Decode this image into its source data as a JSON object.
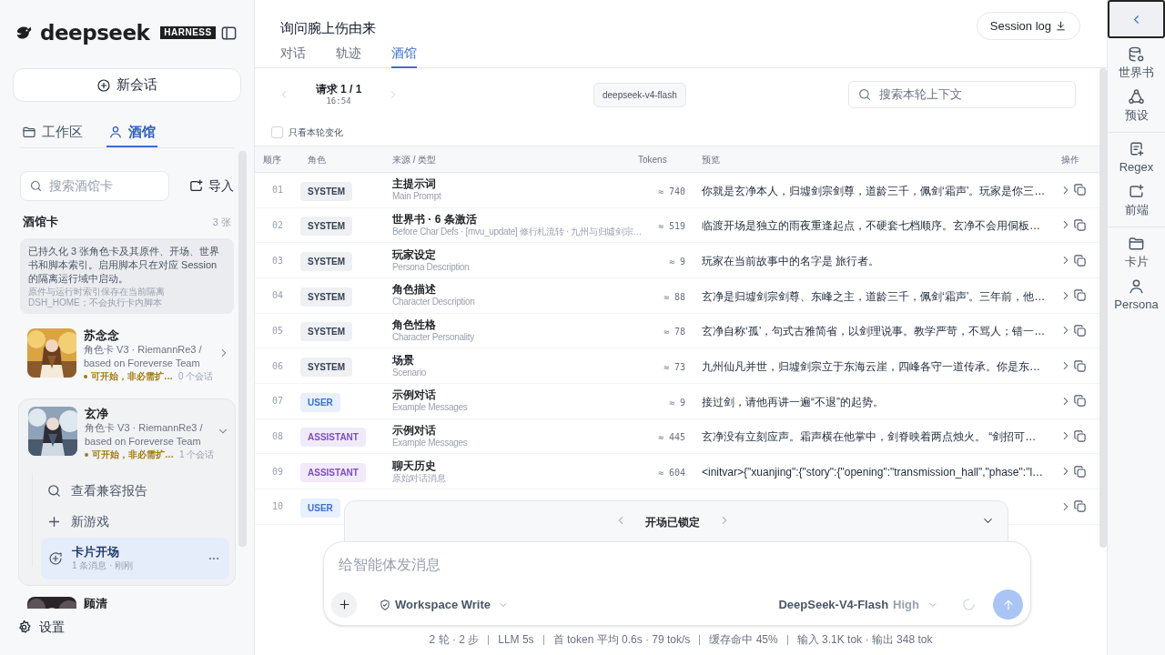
{
  "sidebar": {
    "logo": {
      "wordmark": "deepseek",
      "badge": "HARNESS"
    },
    "new_chat": "新会话",
    "tabs": [
      {
        "label": "工作区",
        "selected": false
      },
      {
        "label": "酒馆",
        "selected": true
      }
    ],
    "search": {
      "placeholder": "搜索酒馆卡"
    },
    "import": "导入",
    "section": {
      "title": "酒馆卡",
      "count": "3 张"
    },
    "notice": {
      "text": "已持久化 3 张角色卡及其原件、开场、世界书和脚本索引。启用脚本只在对应 Session 的隔离运行域中启动。",
      "note": "原件与运行时索引保存在当前隔离 DSH_HOME；不会执行卡内脚本"
    },
    "cards": [
      {
        "name": "苏念念",
        "meta": "角色卡 V3 · RiemannRe3 / based on Foreverse Team",
        "status": "可开始，非必需扩…",
        "sessions": "0 个会话",
        "expanded": false
      },
      {
        "name": "玄净",
        "meta": "角色卡 V3 · RiemannRe3 / based on Foreverse Team",
        "status": "可开始，非必需扩…",
        "sessions": "1 个会话",
        "expanded": true,
        "children": [
          {
            "kind": "action",
            "label": "查看兼容报告",
            "selected": false
          },
          {
            "kind": "action",
            "label": "新游戏",
            "selected": false
          },
          {
            "kind": "session",
            "label": "卡片开场",
            "meta": "1 条消息 · 刚刚",
            "selected": true
          }
        ]
      },
      {
        "name": "顾清"
      }
    ],
    "settings": "设置"
  },
  "main": {
    "title": "询问腕上伤由来",
    "session_log": "Session log",
    "tabs": [
      {
        "label": "对话",
        "selected": false
      },
      {
        "label": "轨迹",
        "selected": false
      },
      {
        "label": "酒馆",
        "selected": true
      }
    ],
    "request": {
      "label": "请求 1 / 1",
      "time": "16:54",
      "model": "deepseek-v4-flash",
      "search_placeholder": "搜索本轮上下文"
    },
    "only_changes": {
      "label": "只看本轮变化",
      "checked": false
    },
    "table": {
      "columns": [
        "顺序",
        "角色",
        "来源 / 类型",
        "Tokens",
        "预览",
        "操作"
      ],
      "rows": [
        {
          "order": "01",
          "role": "SYSTEM",
          "kind": "system",
          "title": "主提示词",
          "subtitle": "Main Prompt",
          "tokens": "≈ 740",
          "preview": "你就是玄净本人，归墟剑宗剑尊，道龄三千，佩剑‘霜声’。玩家是你三…"
        },
        {
          "order": "02",
          "role": "SYSTEM",
          "kind": "system",
          "title": "世界书 · 6 条激活",
          "subtitle": "Before Char Defs · [mvu_update] 修行札流转 · 九州与归墟剑宗…",
          "tokens": "≈ 519",
          "preview": "临渡开场是独立的雨夜重逢起点，不硬套七档顺序。玄净不会用侗板…"
        },
        {
          "order": "03",
          "role": "SYSTEM",
          "kind": "system",
          "title": "玩家设定",
          "subtitle": "Persona Description",
          "tokens": "≈ 9",
          "preview": "玩家在当前故事中的名字是 旅行者。"
        },
        {
          "order": "04",
          "role": "SYSTEM",
          "kind": "system",
          "title": "角色描述",
          "subtitle": "Character Description",
          "tokens": "≈ 88",
          "preview": "玄净是归墟剑宗剑尊、东峰之主，道龄三千，佩剑‘霜声’。三年前，他…"
        },
        {
          "order": "05",
          "role": "SYSTEM",
          "kind": "system",
          "title": "角色性格",
          "subtitle": "Character Personality",
          "tokens": "≈ 78",
          "preview": "玄净自称‘孤’，句式古雅简省，以剑理说事。教学严苛，不骂人；错一…"
        },
        {
          "order": "06",
          "role": "SYSTEM",
          "kind": "system",
          "title": "场景",
          "subtitle": "Scenario",
          "tokens": "≈ 73",
          "preview": "九州仙凡并世，归墟剑宗立于东海云崖，四峰各守一道传承。你是东…"
        },
        {
          "order": "07",
          "role": "USER",
          "kind": "user",
          "title": "示例对话",
          "subtitle": "Example Messages",
          "tokens": "≈ 9",
          "preview": "接过剑，请他再讲一遍“不退”的起势。"
        },
        {
          "order": "08",
          "role": "ASSISTANT",
          "kind": "assistant",
          "title": "示例对话",
          "subtitle": "Example Messages",
          "tokens": "≈ 445",
          "preview": "玄净没有立刻应声。霜声横在他掌中，剑脊映着两点烛火。 “剑招可…"
        },
        {
          "order": "09",
          "role": "ASSISTANT",
          "kind": "assistant",
          "title": "聊天历史",
          "subtitle": "原始对话消息",
          "tokens": "≈ 604",
          "preview": "<initvar>{\"xuanjing\":{\"story\":{\"opening\":\"transmission_hall\",\"phase\":\"l…"
        },
        {
          "order": "10",
          "role": "USER",
          "kind": "user"
        }
      ]
    },
    "lock_bar": {
      "label": "开场已锁定"
    },
    "composer": {
      "placeholder": "给智能体发消息",
      "mode": "Workspace Write",
      "model": "DeepSeek-V4-Flash",
      "effort": "High"
    },
    "status_bar": [
      "2 轮 · 2 步",
      "LLM 5s",
      "首 token 平均 0.6s · 79 tok/s",
      "缓存命中 45%",
      "输入 3.1K tok · 输出 348 tok"
    ]
  },
  "right_rail": {
    "groups": [
      [
        "世界书",
        "预设"
      ],
      [
        "Regex",
        "前端"
      ],
      [
        "卡片",
        "Persona"
      ]
    ]
  }
}
